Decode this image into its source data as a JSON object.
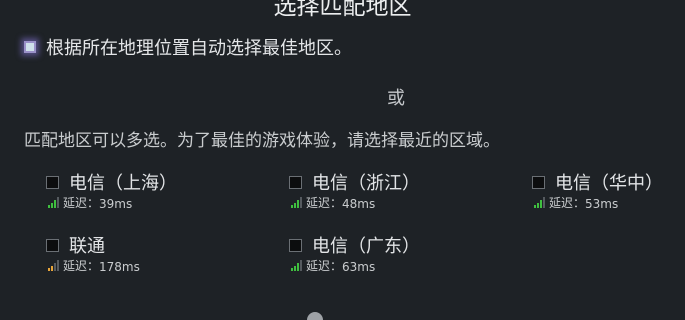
{
  "dialog": {
    "title": "选择匹配地区",
    "auto_select_label": "根据所在地理位置自动选择最佳地区。",
    "or_text": "或",
    "instructions": "匹配地区可以多选。为了最佳的游戏体验，请选择最近的区域。",
    "latency_label": "延迟：",
    "regions": [
      {
        "name": "电信（上海）",
        "latency": "39ms",
        "signal": {
          "icon": "signal-bars-icon",
          "level": 3,
          "max": 4,
          "color": "#3fbf3f"
        }
      },
      {
        "name": "电信（浙江）",
        "latency": "48ms",
        "signal": {
          "icon": "signal-bars-icon",
          "level": 3,
          "max": 4,
          "color": "#3fbf3f"
        }
      },
      {
        "name": "电信（华中）",
        "latency": "53ms",
        "signal": {
          "icon": "signal-bars-icon",
          "level": 3,
          "max": 4,
          "color": "#3fbf3f"
        }
      },
      {
        "name": "联通",
        "latency": "178ms",
        "signal": {
          "icon": "signal-bars-icon",
          "level": 2,
          "max": 4,
          "color": "#e8a53a"
        }
      },
      {
        "name": "电信（广东）",
        "latency": "63ms",
        "signal": {
          "icon": "signal-bars-icon",
          "level": 3,
          "max": 4,
          "color": "#3fbf3f"
        }
      }
    ]
  },
  "colors": {
    "background": "#1e2226",
    "signal_good": "#3fbf3f",
    "signal_fair": "#e8a53a",
    "signal_empty": "#555a5f"
  }
}
